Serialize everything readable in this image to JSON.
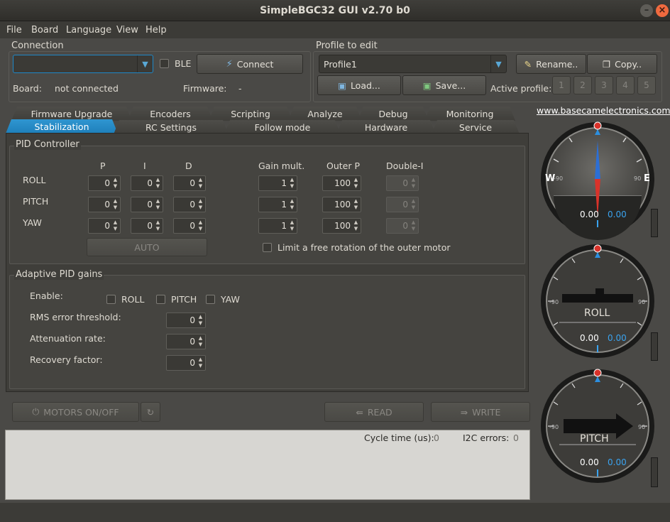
{
  "window": {
    "title": "SimpleBGC32 GUI v2.70 b0"
  },
  "menu": [
    "File",
    "Board",
    "Language",
    "View",
    "Help"
  ],
  "connection": {
    "group_label": "Connection",
    "port_value": "",
    "ble_label": "BLE",
    "connect_label": "Connect",
    "board_label": "Board:",
    "board_value": "not connected",
    "firmware_label": "Firmware:",
    "firmware_value": "-"
  },
  "profile": {
    "group_label": "Profile to edit",
    "selected": "Profile1",
    "rename_label": "Rename..",
    "copy_label": "Copy..",
    "load_label": "Load...",
    "save_label": "Save...",
    "active_label": "Active profile:",
    "active_buttons": [
      "1",
      "2",
      "3",
      "4",
      "5"
    ]
  },
  "tabs_row1": [
    "Firmware Upgrade",
    "Encoders",
    "Scripting",
    "Analyze",
    "Debug",
    "Monitoring"
  ],
  "tabs_row2": [
    "Stabilization",
    "RC Settings",
    "Follow mode",
    "Hardware",
    "Service"
  ],
  "pid": {
    "group_label": "PID Controller",
    "col_p": "P",
    "col_i": "I",
    "col_d": "D",
    "col_gain": "Gain mult.",
    "col_outer": "Outer P",
    "col_double": "Double-I",
    "rows": [
      {
        "label": "ROLL",
        "p": "0",
        "i": "0",
        "d": "0",
        "gain": "1",
        "outer": "100",
        "double": "0"
      },
      {
        "label": "PITCH",
        "p": "0",
        "i": "0",
        "d": "0",
        "gain": "1",
        "outer": "100",
        "double": "0"
      },
      {
        "label": "YAW",
        "p": "0",
        "i": "0",
        "d": "0",
        "gain": "1",
        "outer": "100",
        "double": "0"
      }
    ],
    "auto_label": "AUTO",
    "limit_label": "Limit a free rotation of the outer motor"
  },
  "adaptive": {
    "group_label": "Adaptive PID gains",
    "enable_label": "Enable:",
    "roll_label": "ROLL",
    "pitch_label": "PITCH",
    "yaw_label": "YAW",
    "rms_label": "RMS error threshold:",
    "rms_value": "0",
    "atten_label": "Attenuation rate:",
    "atten_value": "0",
    "recovery_label": "Recovery factor:",
    "recovery_value": "0"
  },
  "bottom": {
    "motors_label": "MOTORS ON/OFF",
    "read_label": "READ",
    "write_label": "WRITE",
    "cycle_label": "Cycle time (us):",
    "cycle_value": "0",
    "i2c_label": "I2C errors:",
    "i2c_value": "0"
  },
  "gauges": {
    "link": "www.basecamelectronics.com",
    "yaw": {
      "left_letter": "W",
      "right_letter": "E",
      "left_tick": "-90",
      "right_tick": "90",
      "value_a": "0.00",
      "value_b": "0.00"
    },
    "roll": {
      "name": "ROLL",
      "left_tick": "-90",
      "right_tick": "90",
      "value_a": "0.00",
      "value_b": "0.00"
    },
    "pitch": {
      "name": "PITCH",
      "left_tick": "-90",
      "right_tick": "90",
      "value_a": "0.00",
      "value_b": "0.00"
    }
  },
  "colors": {
    "accent": "#1e88c8",
    "value_blue": "#3aa3ef",
    "needle_red": "#d9322a"
  }
}
